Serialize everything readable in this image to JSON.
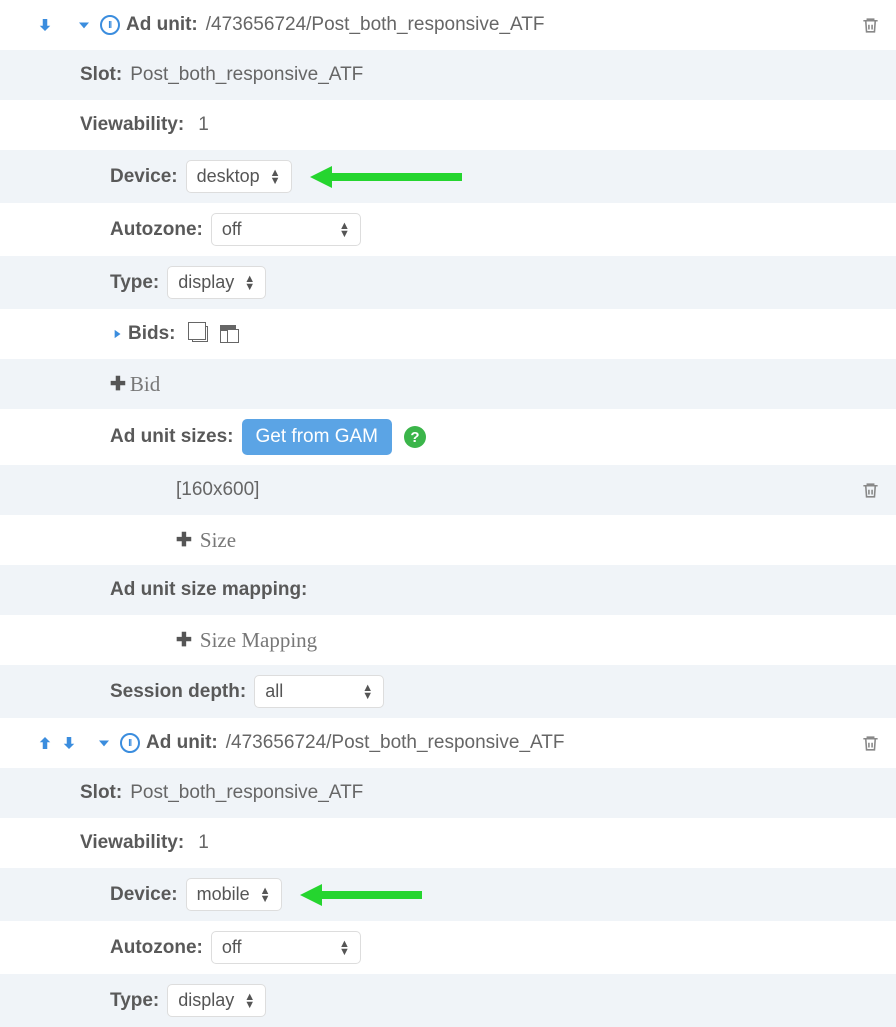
{
  "labels": {
    "ad_unit": "Ad unit:",
    "slot": "Slot:",
    "viewability": "Viewability:",
    "device": "Device:",
    "autozone": "Autozone:",
    "type": "Type:",
    "bids": "Bids:",
    "bid_add": "Bid",
    "sizes": "Ad unit sizes:",
    "size_add": "Size",
    "size_mapping": "Ad unit size mapping:",
    "size_mapping_add": "Size Mapping",
    "session_depth": "Session depth:",
    "get_from_gam": "Get from GAM"
  },
  "units": [
    {
      "path": "/473656724/Post_both_responsive_ATF",
      "slot": "Post_both_responsive_ATF",
      "viewability": "1",
      "device": "desktop",
      "autozone": "off",
      "type": "display",
      "sizes": [
        "[160x600]"
      ],
      "session_depth": "all"
    },
    {
      "path": "/473656724/Post_both_responsive_ATF",
      "slot": "Post_both_responsive_ATF",
      "viewability": "1",
      "device": "mobile",
      "autozone": "off",
      "type": "display"
    }
  ]
}
